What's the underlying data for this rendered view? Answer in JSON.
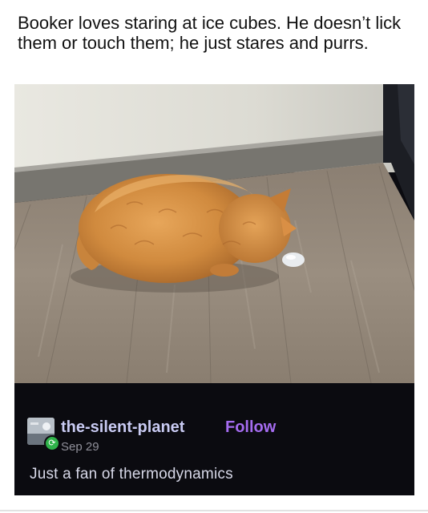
{
  "post": {
    "caption": "Booker loves staring at ice cubes. He doesn’t lick them or touch them; he just stares and purrs.",
    "reblog": {
      "blog_name": "the-silent-planet",
      "follow_label": "Follow",
      "date": "Sep 29",
      "text": "Just a fan of thermodynamics"
    }
  },
  "colors": {
    "post_background": "#0b0b10",
    "blog_name": "#c9cbf3",
    "follow": "#a56cf0",
    "reblog_badge": "#2fb34a"
  },
  "icons": {
    "avatar": "avatar-image",
    "badge": "reblog-icon"
  }
}
